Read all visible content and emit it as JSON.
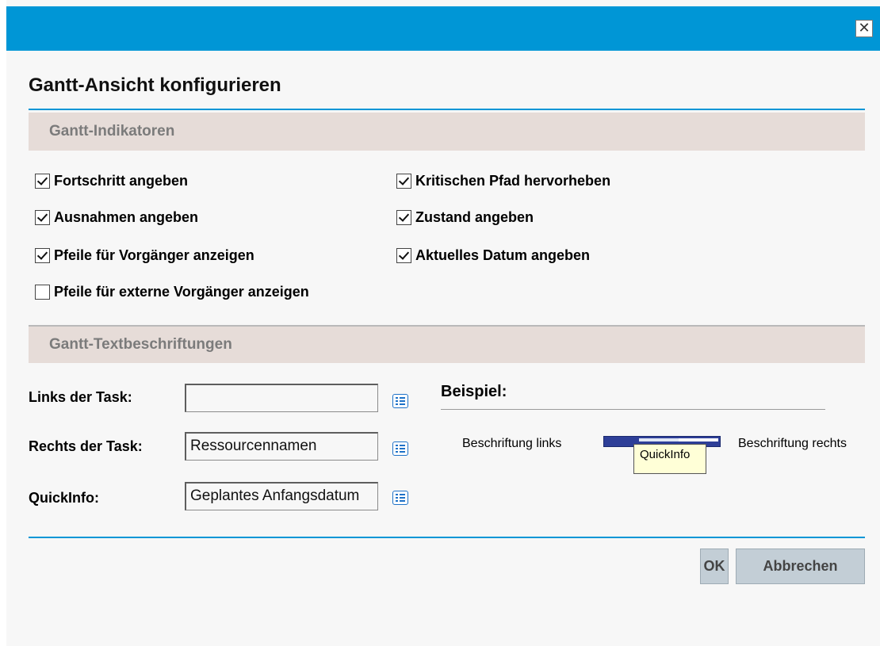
{
  "dialog": {
    "title": "Gantt-Ansicht konfigurieren",
    "close_glyph": "✕"
  },
  "indicators": {
    "header": "Gantt-Indikatoren",
    "items": [
      {
        "label": "Fortschritt angeben",
        "checked": true
      },
      {
        "label": "Kritischen Pfad hervorheben",
        "checked": true
      },
      {
        "label": "Ausnahmen angeben",
        "checked": true
      },
      {
        "label": "Zustand angeben",
        "checked": true
      },
      {
        "label": "Pfeile für Vorgänger anzeigen",
        "checked": true
      },
      {
        "label": "Aktuelles Datum angeben",
        "checked": true
      },
      {
        "label": "Pfeile für externe Vorgänger anzeigen",
        "checked": false
      }
    ]
  },
  "labels": {
    "header": "Gantt-Textbeschriftungen",
    "fields": [
      {
        "label": "Links der Task:",
        "value": ""
      },
      {
        "label": "Rechts der Task:",
        "value": "Ressourcennamen"
      },
      {
        "label": "QuickInfo:",
        "value": "Geplantes Anfangsdatum"
      }
    ],
    "icon": "list-icon"
  },
  "example": {
    "title": "Beispiel:",
    "left_label": "Beschriftung links",
    "right_label": "Beschriftung rechts",
    "tooltip": "QuickInfo"
  },
  "buttons": {
    "ok": "OK",
    "cancel": "Abbrechen"
  },
  "colors": {
    "accent": "#0096d6",
    "section_bg": "#e6dcd8",
    "bar": "#2e3f98",
    "tooltip_bg": "#ffffd7"
  }
}
